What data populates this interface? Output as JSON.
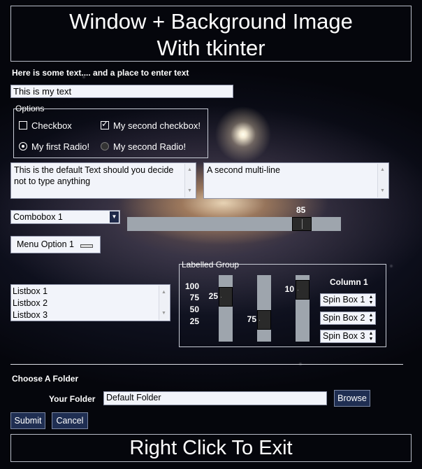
{
  "window": {
    "title_line1": "Window + Background Image",
    "title_line2": "With tkinter",
    "footer": "Right Click To Exit"
  },
  "text_entry": {
    "label": "Here is some text.... and a place to enter text",
    "value": "This is my text"
  },
  "options": {
    "title": "Options",
    "checkbox1": {
      "label": "Checkbox",
      "checked": false
    },
    "checkbox2": {
      "label": "My second checkbox!",
      "checked": true
    },
    "radio1": {
      "label": "My first Radio!",
      "selected": true
    },
    "radio2": {
      "label": "My second Radio!",
      "selected": false
    }
  },
  "multiline": {
    "first": "This is the default Text should you decide not to type anything",
    "second": "A second multi-line"
  },
  "combobox": {
    "value": "Combobox 1"
  },
  "hslider": {
    "value": "85",
    "level": 85,
    "min": 0,
    "max": 100
  },
  "option_menu": {
    "value": "Menu Option 1"
  },
  "listbox": {
    "items": [
      "Listbox 1",
      "Listbox 2",
      "Listbox 3"
    ]
  },
  "labelled_group": {
    "title": "Labelled Group",
    "ticks": [
      "100",
      "75",
      "50",
      "25"
    ],
    "vslider1": {
      "value": "25",
      "level": 25
    },
    "vslider2": {
      "value": "75",
      "level": 75
    },
    "vslider3": {
      "value": "10",
      "level": 10
    },
    "column_title": "Column 1",
    "spinboxes": [
      "Spin Box 1",
      "Spin Box 2",
      "Spin Box 3"
    ]
  },
  "folder": {
    "heading": "Choose A Folder",
    "label": "Your Folder",
    "value": "Default Folder",
    "browse": "Browse"
  },
  "buttons": {
    "submit": "Submit",
    "cancel": "Cancel"
  },
  "colors": {
    "button_bg": "#1f2e52",
    "trough": "#9ea5ad",
    "field_bg": "#f2f4fa"
  }
}
